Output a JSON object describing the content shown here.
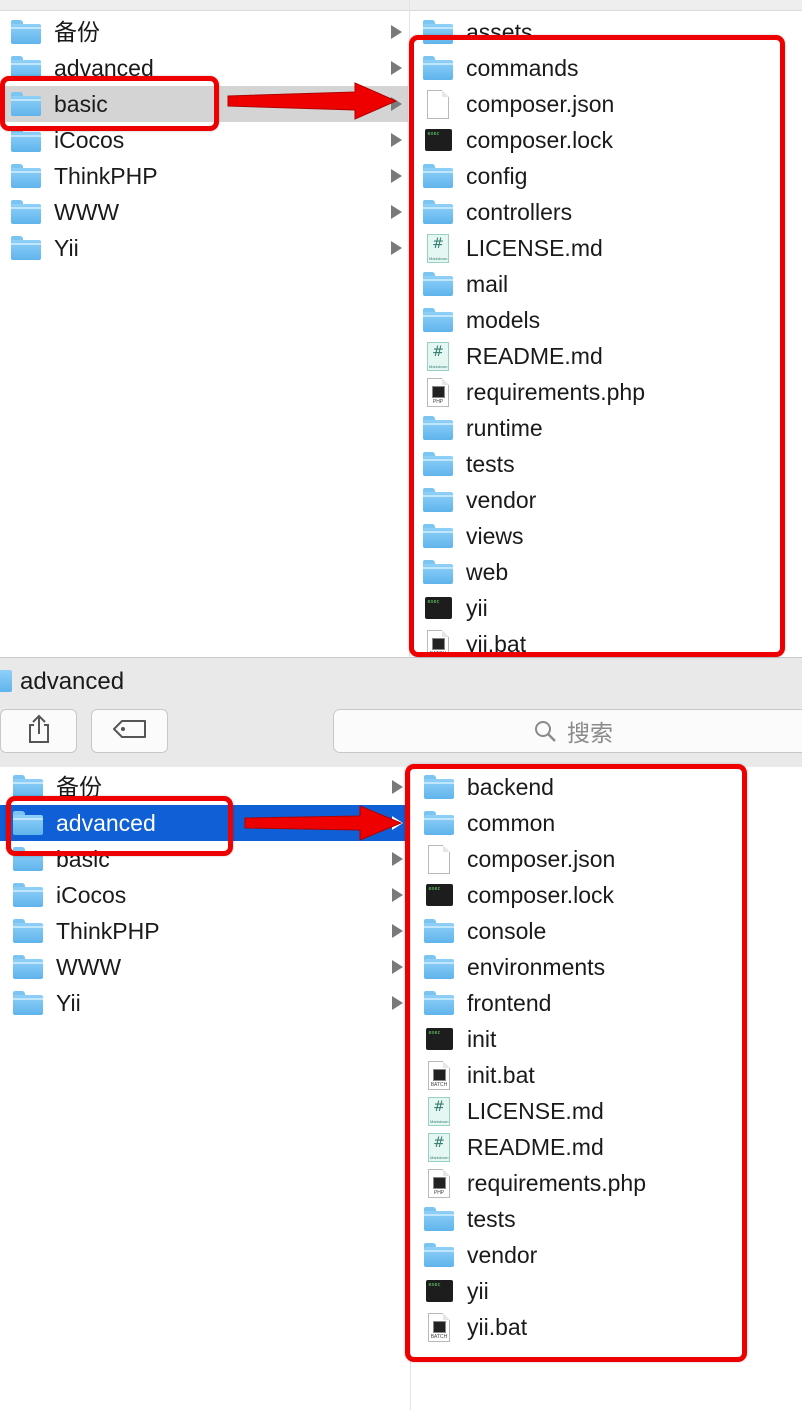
{
  "window_top": {
    "sidebar_items": [
      {
        "label": "备份",
        "icon": "folder-icon"
      },
      {
        "label": "advanced",
        "icon": "folder-icon"
      },
      {
        "label": "basic",
        "icon": "folder-icon",
        "selected": true
      },
      {
        "label": "iCocos",
        "icon": "folder-icon"
      },
      {
        "label": "ThinkPHP",
        "icon": "folder-icon"
      },
      {
        "label": "WWW",
        "icon": "folder-icon"
      },
      {
        "label": "Yii",
        "icon": "folder-icon"
      }
    ],
    "contents": [
      {
        "label": "assets",
        "icon": "folder-icon"
      },
      {
        "label": "commands",
        "icon": "folder-icon"
      },
      {
        "label": "composer.json",
        "icon": "file-icon"
      },
      {
        "label": "composer.lock",
        "icon": "terminal-icon"
      },
      {
        "label": "config",
        "icon": "folder-icon"
      },
      {
        "label": "controllers",
        "icon": "folder-icon"
      },
      {
        "label": "LICENSE.md",
        "icon": "markdown-icon"
      },
      {
        "label": "mail",
        "icon": "folder-icon"
      },
      {
        "label": "models",
        "icon": "folder-icon"
      },
      {
        "label": "README.md",
        "icon": "markdown-icon"
      },
      {
        "label": "requirements.php",
        "icon": "php-file-icon"
      },
      {
        "label": "runtime",
        "icon": "folder-icon"
      },
      {
        "label": "tests",
        "icon": "folder-icon"
      },
      {
        "label": "vendor",
        "icon": "folder-icon"
      },
      {
        "label": "views",
        "icon": "folder-icon"
      },
      {
        "label": "web",
        "icon": "folder-icon"
      },
      {
        "label": "yii",
        "icon": "terminal-icon"
      },
      {
        "label": "yii.bat",
        "icon": "batch-file-icon"
      }
    ]
  },
  "toolbar": {
    "path_title": "advanced",
    "share_icon": "share-icon",
    "tag_icon": "tag-icon",
    "search_placeholder": "搜索"
  },
  "window_bottom": {
    "sidebar_items": [
      {
        "label": "备份",
        "icon": "folder-icon"
      },
      {
        "label": "advanced",
        "icon": "folder-icon",
        "selected": true
      },
      {
        "label": "basic",
        "icon": "folder-icon"
      },
      {
        "label": "iCocos",
        "icon": "folder-icon"
      },
      {
        "label": "ThinkPHP",
        "icon": "folder-icon"
      },
      {
        "label": "WWW",
        "icon": "folder-icon"
      },
      {
        "label": "Yii",
        "icon": "folder-icon"
      }
    ],
    "contents": [
      {
        "label": "backend",
        "icon": "folder-icon"
      },
      {
        "label": "common",
        "icon": "folder-icon"
      },
      {
        "label": "composer.json",
        "icon": "file-icon"
      },
      {
        "label": "composer.lock",
        "icon": "terminal-icon"
      },
      {
        "label": "console",
        "icon": "folder-icon"
      },
      {
        "label": "environments",
        "icon": "folder-icon"
      },
      {
        "label": "frontend",
        "icon": "folder-icon"
      },
      {
        "label": "init",
        "icon": "terminal-icon"
      },
      {
        "label": "init.bat",
        "icon": "batch-file-icon"
      },
      {
        "label": "LICENSE.md",
        "icon": "markdown-icon"
      },
      {
        "label": "README.md",
        "icon": "markdown-icon"
      },
      {
        "label": "requirements.php",
        "icon": "php-file-icon"
      },
      {
        "label": "tests",
        "icon": "folder-icon"
      },
      {
        "label": "vendor",
        "icon": "folder-icon"
      },
      {
        "label": "yii",
        "icon": "terminal-icon"
      },
      {
        "label": "yii.bat",
        "icon": "batch-file-icon"
      }
    ]
  },
  "colors": {
    "highlight_red": "#ee0000",
    "selection_blue": "#0f5fd6",
    "selection_gray": "#d4d4d4"
  }
}
